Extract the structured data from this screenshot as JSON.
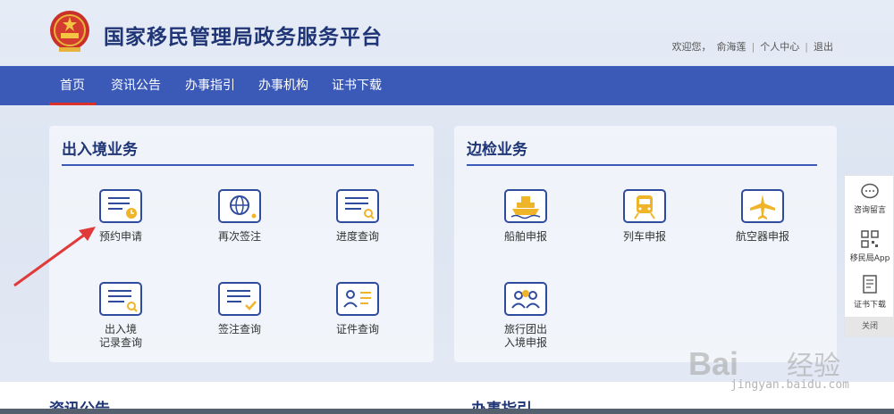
{
  "header": {
    "title": "国家移民管理局政务服务平台",
    "welcome": "欢迎您，",
    "username": "俞海莲",
    "user_center": "个人中心",
    "logout": "退出"
  },
  "nav": {
    "items": [
      "首页",
      "资讯公告",
      "办事指引",
      "办事机构",
      "证书下载"
    ],
    "active": "首页"
  },
  "panels": {
    "entry_exit": {
      "title": "出入境业务",
      "services": [
        "预约申请",
        "再次签注",
        "进度查询",
        "出入境\n记录查询",
        "签注查询",
        "证件查询"
      ]
    },
    "border": {
      "title": "边检业务",
      "services": [
        "船舶申报",
        "列车申报",
        "航空器申报",
        "旅行团出\n入境申报"
      ]
    }
  },
  "floatbar": {
    "items": [
      "咨询留言",
      "移民局App",
      "证书下载"
    ],
    "close": "关闭"
  },
  "bottom": {
    "left_title": "资讯公告",
    "right_title": "办事指引"
  },
  "watermark": {
    "brand": "Bai经验",
    "url": "jingyan.baidu.com"
  },
  "colors": {
    "nav_bg": "#3b5ab8",
    "title": "#1f3576",
    "active_underline": "#d9302a",
    "icon_accent": "#f0b429",
    "annotation_arrow": "#e03a3a"
  }
}
